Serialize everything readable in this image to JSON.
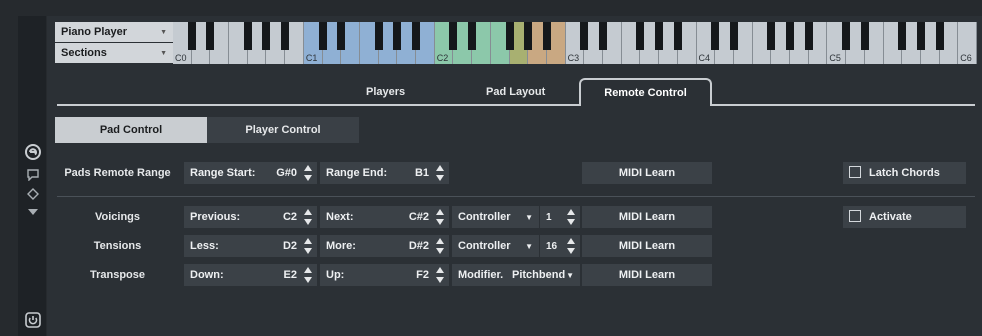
{
  "left_toolbar": {
    "close_icon": "close-icon",
    "icons": [
      "e-logo-icon",
      "comment-icon",
      "tag-icon",
      "triangle-down-icon",
      "power-icon"
    ]
  },
  "header": {
    "player_select": "Piano Player",
    "sections_select": "Sections",
    "octave_labels": [
      "C0",
      "C1",
      "C2",
      "C3",
      "C4",
      "C5",
      "C6"
    ]
  },
  "tabs": {
    "players": "Players",
    "pad_layout": "Pad Layout",
    "remote_control": "Remote Control"
  },
  "subtabs": {
    "pad_control": "Pad Control",
    "player_control": "Player Control"
  },
  "pads_remote_range": {
    "label": "Pads Remote Range",
    "range_start_label": "Range Start:",
    "range_start_value": "G#0",
    "range_end_label": "Range End:",
    "range_end_value": "B1",
    "midi_learn": "MIDI Learn",
    "latch_chords": "Latch Chords"
  },
  "voicings": {
    "label": "Voicings",
    "a_label": "Previous:",
    "a_value": "C2",
    "b_label": "Next:",
    "b_value": "C#2",
    "mode": "Controller",
    "cc": "1",
    "midi_learn": "MIDI Learn",
    "activate": "Activate"
  },
  "tensions": {
    "label": "Tensions",
    "a_label": "Less:",
    "a_value": "D2",
    "b_label": "More:",
    "b_value": "D#2",
    "mode": "Controller",
    "cc": "16",
    "midi_learn": "MIDI Learn"
  },
  "transpose": {
    "label": "Transpose",
    "a_label": "Down:",
    "a_value": "E2",
    "b_label": "Up:",
    "b_value": "F2",
    "mode": "Modifier.",
    "mode2": "Pitchbend",
    "midi_learn": "MIDI Learn"
  },
  "colors": {
    "key_blue": "#8fb0d4",
    "key_green": "#8cc8aa",
    "key_olive": "#a8b071",
    "key_tan": "#c9a882",
    "key_white": "#c5cbd1",
    "accent_light": "#c9cdd1"
  }
}
